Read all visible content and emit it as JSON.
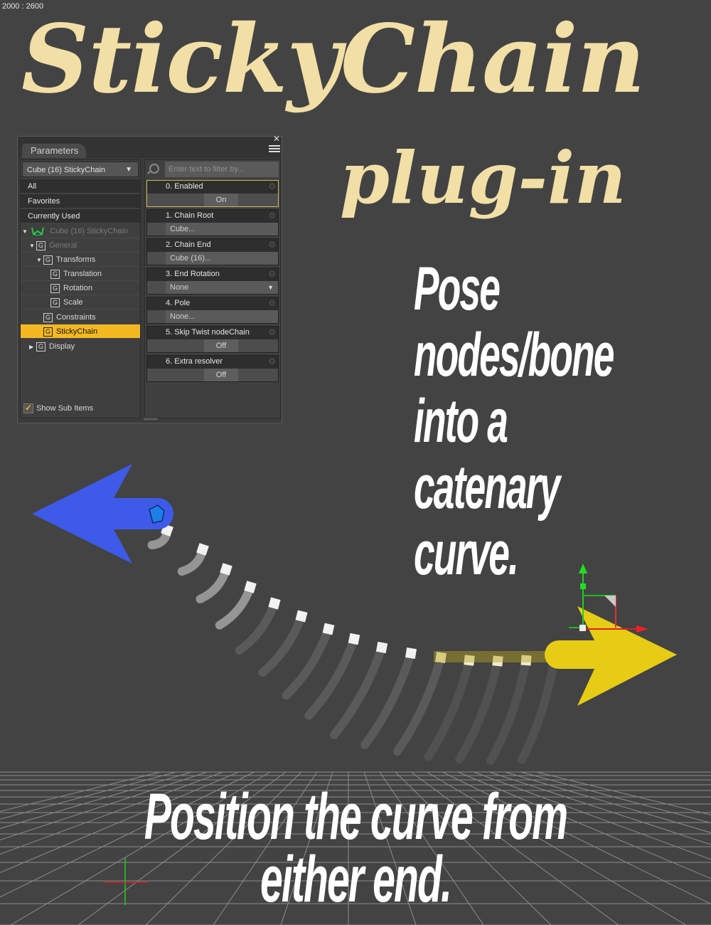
{
  "resolution_label": "2000 : 2600",
  "title": {
    "main": "StickyChain",
    "sub": "plug-in"
  },
  "side_text": [
    "Pose",
    "nodes/bone",
    "into a",
    "catenary",
    "curve."
  ],
  "bottom_text": [
    "Position the curve from",
    "either end."
  ],
  "colors": {
    "title": "#f2dfa6",
    "selection": "#f4b823",
    "blue_arrow": "#3d5be8",
    "yellow_arrow": "#e6cc14"
  },
  "panel": {
    "tab_label": "Parameters",
    "close_icon": "close-icon",
    "menu_icon": "panel-menu-icon",
    "node_selector": "Cube (16) StickyChain",
    "categories": [
      "All",
      "Favorites",
      "Currently Used"
    ],
    "tree": [
      {
        "label": "Cube (16) StickyChain",
        "icon": "chain-icon",
        "state": "dim"
      },
      {
        "label": "General",
        "icon": "group-icon",
        "state": "dim"
      },
      {
        "label": "Transforms",
        "icon": "group-icon",
        "state": "normal"
      },
      {
        "label": "Translation",
        "icon": "group-icon",
        "state": "normal"
      },
      {
        "label": "Rotation",
        "icon": "group-icon",
        "state": "normal"
      },
      {
        "label": "Scale",
        "icon": "group-icon",
        "state": "normal"
      },
      {
        "label": "Constraints",
        "icon": "group-icon",
        "state": "normal"
      },
      {
        "label": "StickyChain",
        "icon": "group-icon",
        "state": "selected"
      },
      {
        "label": "Display",
        "icon": "group-icon",
        "state": "normal"
      }
    ],
    "show_sub_items": {
      "label": "Show Sub Items",
      "checked": true
    },
    "filter_placeholder": "Enter text to filter by...",
    "params": [
      {
        "label": "0. Enabled",
        "value": "On",
        "kind": "toggle"
      },
      {
        "label": "1. Chain Root",
        "value": "Cube...",
        "kind": "node"
      },
      {
        "label": "2. Chain End",
        "value": "Cube (16)...",
        "kind": "node"
      },
      {
        "label": "3. End Rotation",
        "value": "None",
        "kind": "select"
      },
      {
        "label": "4. Pole",
        "value": "None...",
        "kind": "node"
      },
      {
        "label": "5. Skip Twist nodeChain",
        "value": "Off",
        "kind": "toggle"
      },
      {
        "label": "6. Extra resolver",
        "value": "Off",
        "kind": "toggle"
      }
    ]
  }
}
